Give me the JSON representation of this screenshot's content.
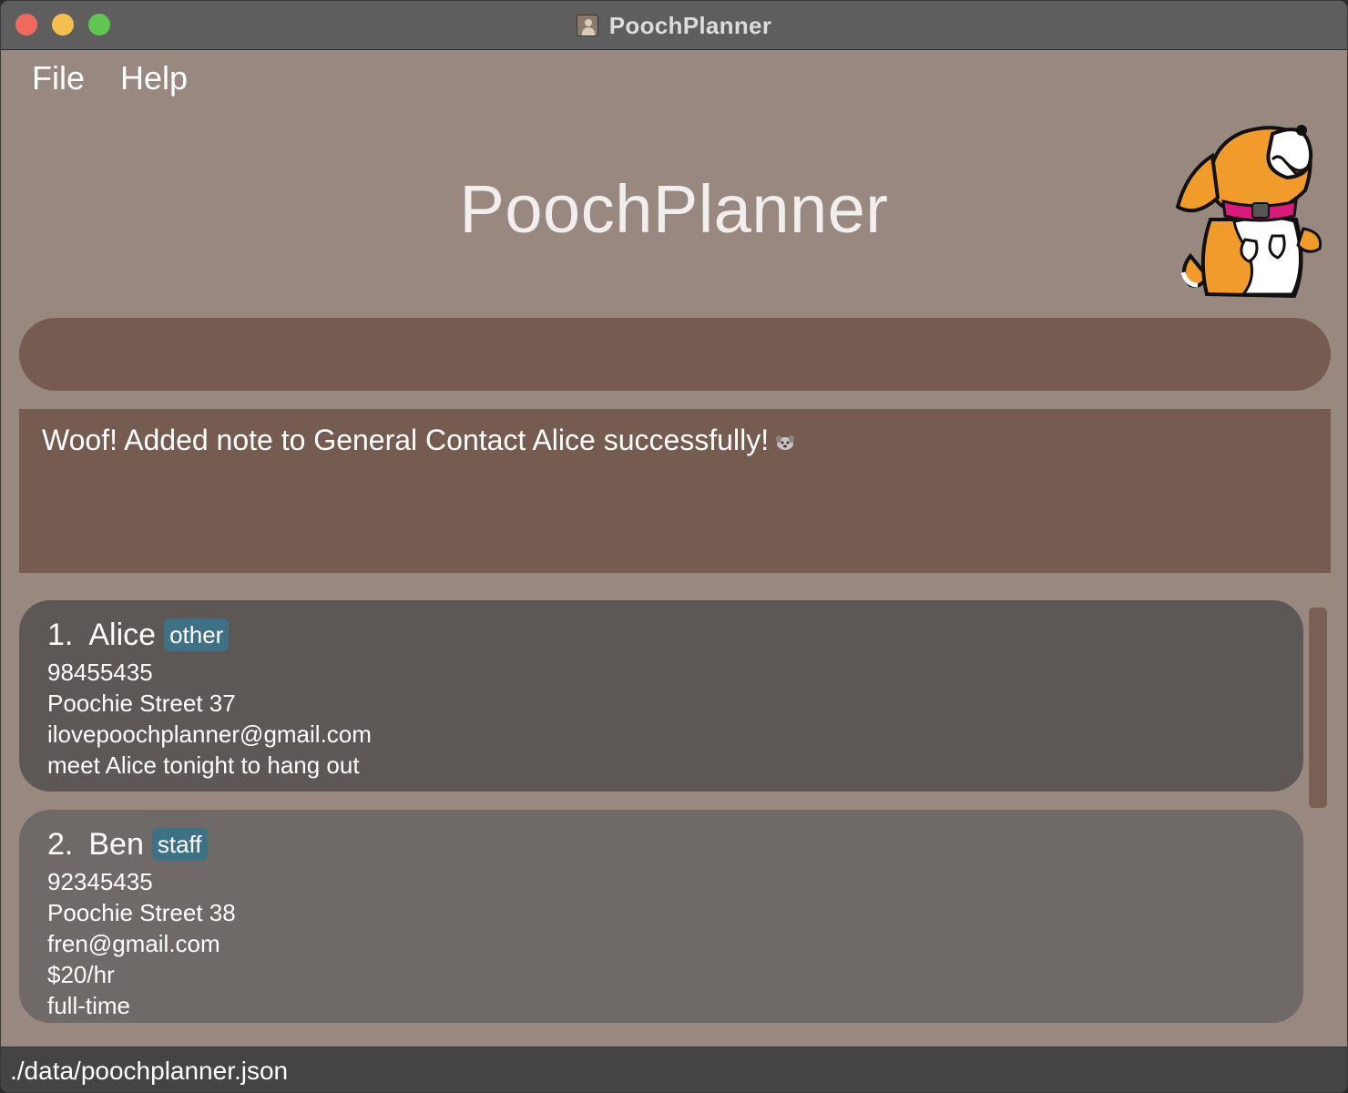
{
  "window": {
    "title": "PoochPlanner"
  },
  "menu": {
    "file": "File",
    "help": "Help"
  },
  "header": {
    "title": "PoochPlanner"
  },
  "command": {
    "value": ""
  },
  "result": {
    "message": "Woof! Added note to General Contact Alice successfully!"
  },
  "contacts": [
    {
      "index": "1.",
      "name": "Alice",
      "tag": "other",
      "phone": "98455435",
      "address": "Poochie Street 37",
      "email": "ilovepoochplanner@gmail.com",
      "note": "meet Alice tonight to hang out"
    },
    {
      "index": "2.",
      "name": "Ben",
      "tag": "staff",
      "phone": "92345435",
      "address": "Poochie Street 38",
      "email": "fren@gmail.com",
      "salary": "$20/hr",
      "employment": "full-time"
    }
  ],
  "status": {
    "path": "./data/poochplanner.json"
  },
  "colors": {
    "background": "#998880",
    "panel": "#765b50",
    "card_selected": "#5d5855",
    "card": "#6f6a67",
    "tag": "#3f7184",
    "statusbar": "#444444"
  }
}
